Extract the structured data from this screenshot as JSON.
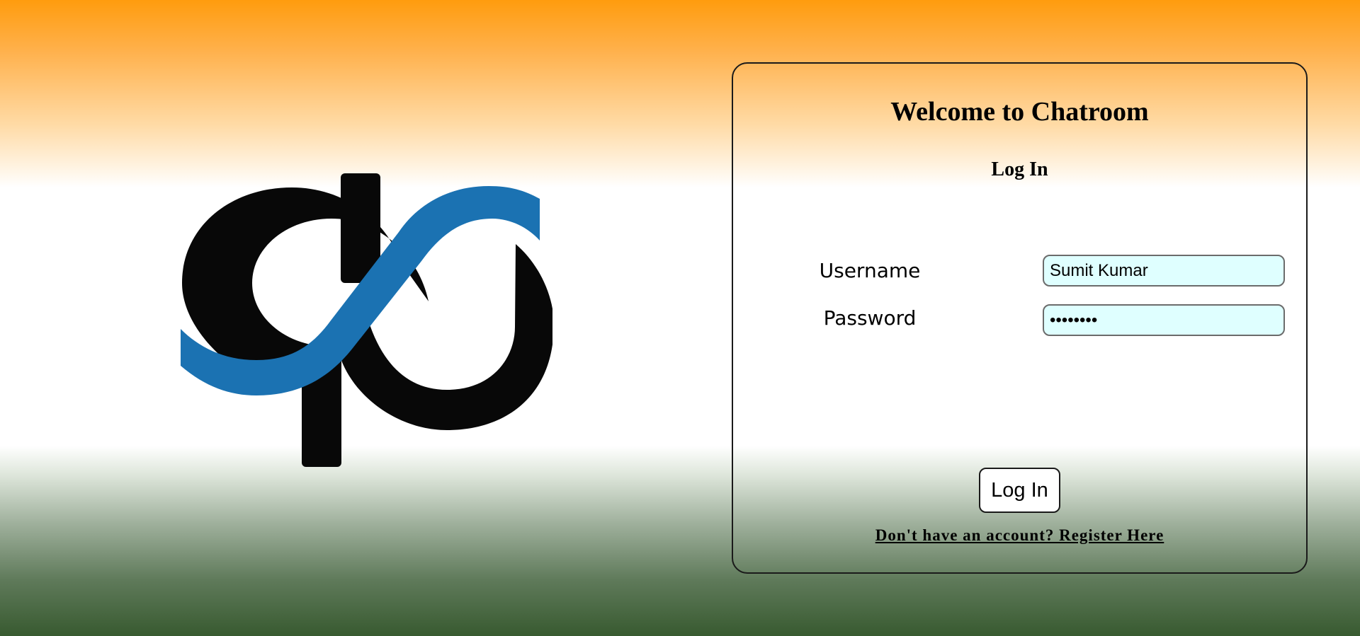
{
  "login_card": {
    "title": "Welcome to Chatroom",
    "subtitle": "Log In",
    "username_label": "Username",
    "username_value": "Sumit Kumar",
    "password_label": "Password",
    "password_value": "password",
    "submit_label": "Log In",
    "register_link": "Don't have an account? Register Here"
  },
  "logo": {
    "icon": "chatroom-infinity-logo",
    "colors": {
      "black": "#080808",
      "blue": "#1b72b2"
    }
  },
  "theme": {
    "background_top": "#ff9c0e",
    "background_middle": "#ffffff",
    "background_bottom": "#385a30",
    "input_background": "#dfffff"
  }
}
